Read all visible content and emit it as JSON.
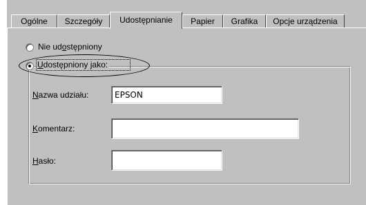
{
  "tabs": [
    {
      "label": "Ogólne"
    },
    {
      "label": "Szczegóły"
    },
    {
      "label": "Udostępnianie"
    },
    {
      "label": "Papier"
    },
    {
      "label": "Grafika"
    },
    {
      "label": "Opcje urządzenia"
    }
  ],
  "sharing": {
    "not_shared": {
      "pre": "Nie ud",
      "accel": "o",
      "post": "stępniony",
      "selected": false
    },
    "shared_as": {
      "pre": "",
      "accel": "U",
      "post": "dostępniony jako:",
      "selected": true
    }
  },
  "fields": {
    "share_name": {
      "accel": "N",
      "rest": "azwa udziału:",
      "value": "EPSON"
    },
    "comment": {
      "accel": "K",
      "rest": "omentarz:",
      "value": ""
    },
    "password": {
      "accel": "H",
      "rest": "asło:",
      "value": ""
    }
  }
}
